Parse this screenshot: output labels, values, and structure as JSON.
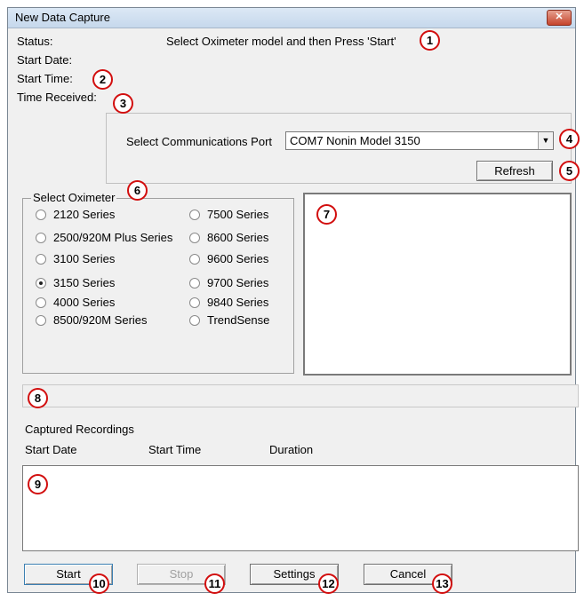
{
  "window": {
    "title": "New Data Capture",
    "close_glyph": "✕"
  },
  "status": {
    "status_label": "Status:",
    "status_text": "Select Oximeter model and then Press 'Start'",
    "start_date_label": "Start Date:",
    "start_time_label": "Start Time:",
    "time_received_label": "Time Received:"
  },
  "comm": {
    "label": "Select Communications Port",
    "selected": "COM7  Nonin Model 3150",
    "arrow_glyph": "▼",
    "refresh_label": "Refresh"
  },
  "oximeter": {
    "legend": "Select Oximeter",
    "options": [
      {
        "label": "2120 Series",
        "selected": false
      },
      {
        "label": "2500/920M Plus Series",
        "selected": false
      },
      {
        "label": "3100 Series",
        "selected": false
      },
      {
        "label": "3150 Series",
        "selected": true
      },
      {
        "label": "4000 Series",
        "selected": false
      },
      {
        "label": "8500/920M Series",
        "selected": false
      },
      {
        "label": "7500 Series",
        "selected": false
      },
      {
        "label": "8600 Series",
        "selected": false
      },
      {
        "label": "9600 Series",
        "selected": false
      },
      {
        "label": "9700 Series",
        "selected": false
      },
      {
        "label": "9840 Series",
        "selected": false
      },
      {
        "label": "TrendSense",
        "selected": false
      }
    ]
  },
  "recordings": {
    "heading": "Captured Recordings",
    "columns": [
      "Start Date",
      "Start Time",
      "Duration"
    ]
  },
  "buttons": {
    "start": "Start",
    "stop": "Stop",
    "settings": "Settings",
    "cancel": "Cancel"
  },
  "callouts": [
    "1",
    "2",
    "3",
    "4",
    "5",
    "6",
    "7",
    "8",
    "9",
    "10",
    "11",
    "12",
    "13"
  ]
}
